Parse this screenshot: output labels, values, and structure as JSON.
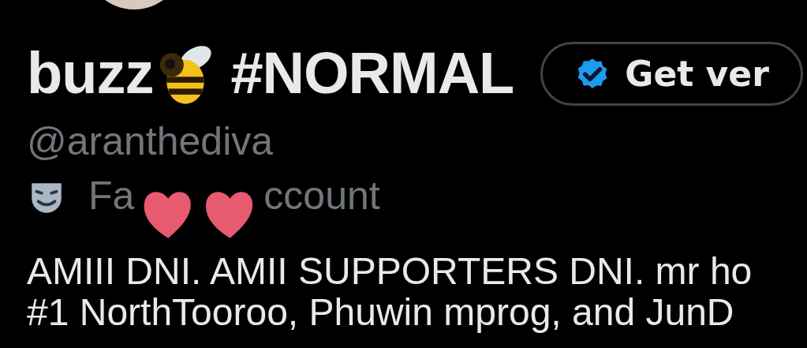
{
  "profile": {
    "name": "buzz",
    "name_tag": "#NORMAL",
    "verify_button": "Get ver",
    "handle": "@aranthediva",
    "category_parts": [
      "Fa",
      "ccount"
    ],
    "bio_lines": [
      "AMIII DNI. AMII SUPPORTERS DNI. mr ho",
      "#1 NorthTooroo, Phuwin mprog, and JunD"
    ]
  }
}
